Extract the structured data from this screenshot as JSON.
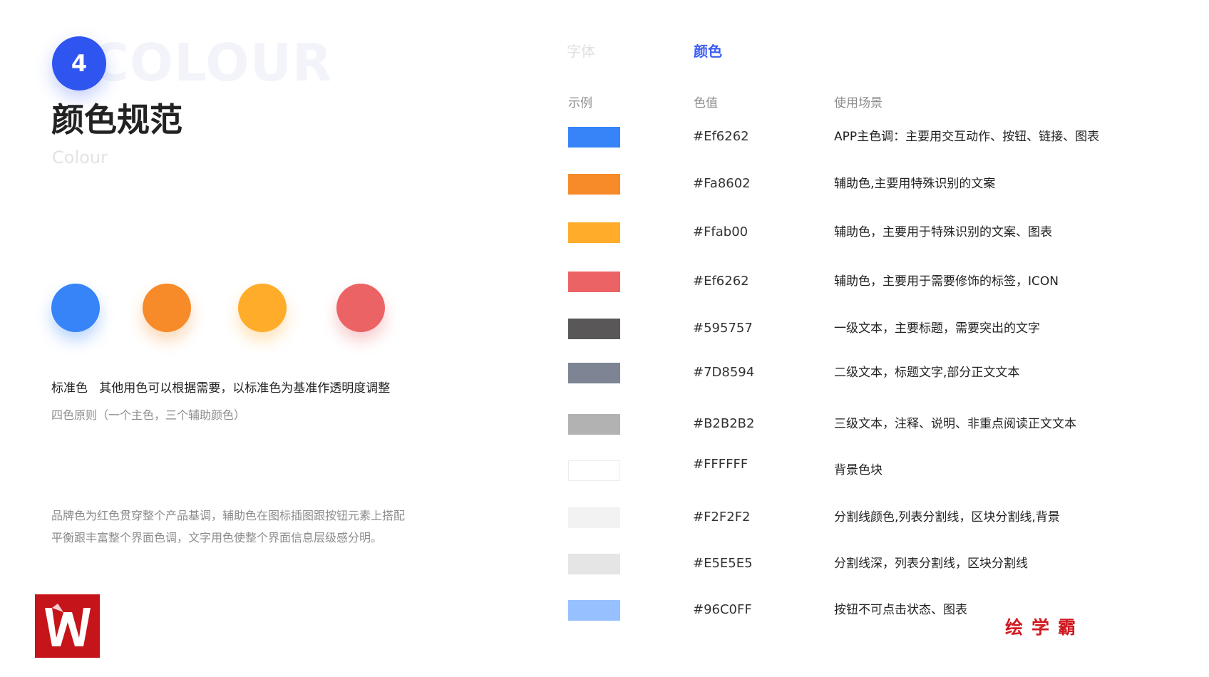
{
  "header": {
    "badge_number": "4",
    "watermark": "COLOUR",
    "title": "颜色规范",
    "subtitle": "Colour"
  },
  "palette_dots": [
    {
      "color": "#3684f8"
    },
    {
      "color": "#f78a29"
    },
    {
      "color": "#ffac2a"
    },
    {
      "color": "#ec6365"
    }
  ],
  "standard": {
    "line": "标准色   其他用色可以根据需要，以标准色为基准作透明度调整",
    "principle": "四色原则（一个主色，三个辅助颜色）"
  },
  "brand_description": "品牌色为红色贯穿整个产品基调，辅助色在图标插图跟按钮元素上搭配平衡跟丰富整个界面色调，文字用色使整个界面信息层级感分明。",
  "tabs": {
    "font": "字体",
    "color": "颜色"
  },
  "table": {
    "headers": {
      "example": "示例",
      "value": "色值",
      "usage": "使用场景"
    },
    "rows": [
      {
        "swatch": "#3684f8",
        "hex": "#Ef6262",
        "usage": "APP主色调：主要用交互动作、按钮、链接、图表"
      },
      {
        "swatch": "#f78a29",
        "hex": "#Fa8602",
        "usage": "辅助色,主要用特殊识别的文案"
      },
      {
        "swatch": "#ffac2a",
        "hex": "#Ffab00",
        "usage": "辅助色，主要用于特殊识别的文案、图表"
      },
      {
        "swatch": "#ec6365",
        "hex": "#Ef6262",
        "usage": "辅助色，主要用于需要修饰的标签，ICON"
      },
      {
        "swatch": "#595757",
        "hex": "#595757",
        "usage": "一级文本，主要标题，需要突出的文字"
      },
      {
        "swatch": "#7d8594",
        "hex": "#7D8594",
        "usage": "二级文本，标题文字,部分正文文本"
      },
      {
        "swatch": "#b2b2b2",
        "hex": "#B2B2B2",
        "usage": "三级文本，注释、说明、非重点阅读正文文本"
      },
      {
        "swatch": "#ffffff",
        "hex": "#FFFFFF",
        "usage": "背景色块"
      },
      {
        "swatch": "#f2f2f2",
        "hex": "#F2F2F2",
        "usage": "分割线颜色,列表分割线，区块分割线,背景"
      },
      {
        "swatch": "#e5e5e5",
        "hex": "#E5E5E5",
        "usage": "分割线深，列表分割线，区块分割线"
      },
      {
        "swatch": "#96c0ff",
        "hex": "#96C0FF",
        "usage": "按钮不可点击状态、图表"
      }
    ]
  },
  "brand_mark": "绘学霸",
  "logo": {
    "letter": "W"
  }
}
